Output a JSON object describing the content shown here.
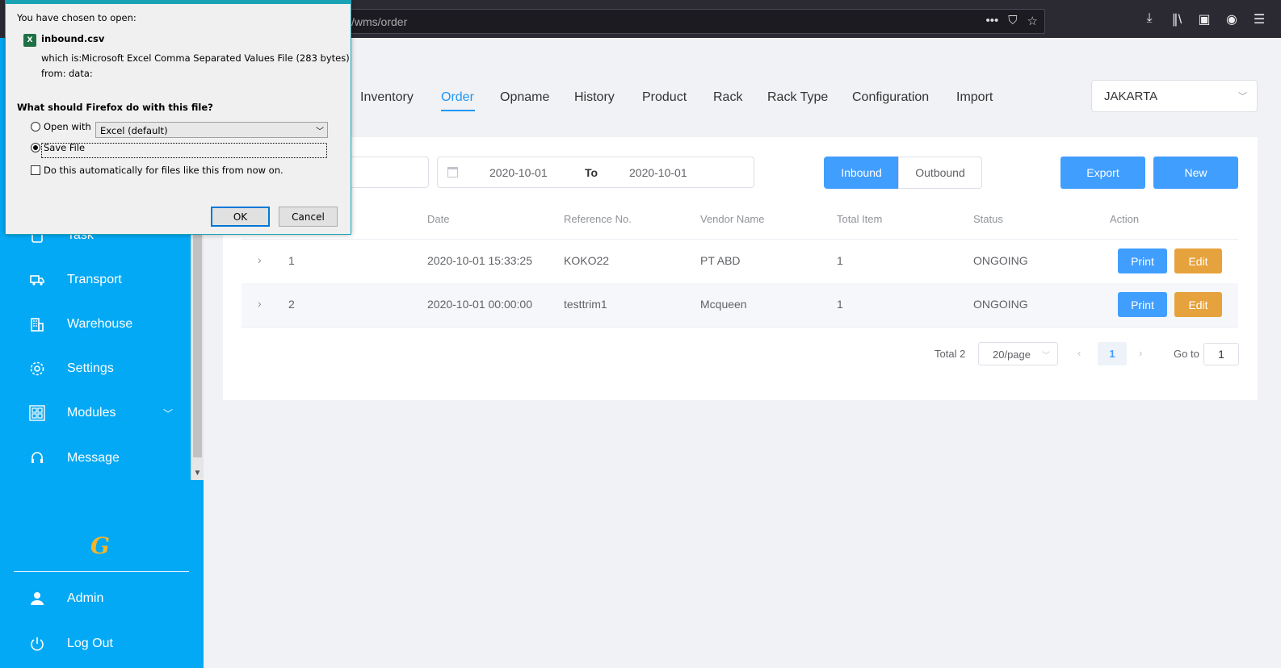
{
  "browser": {
    "url": "/wms/order",
    "url_prefix": "..."
  },
  "sidebar": {
    "items": [
      {
        "label": "Task",
        "icon": "clipboard-icon"
      },
      {
        "label": "Transport",
        "icon": "truck-icon"
      },
      {
        "label": "Warehouse",
        "icon": "building-icon"
      },
      {
        "label": "Settings",
        "icon": "gear-icon"
      },
      {
        "label": "Modules",
        "icon": "modules-icon"
      },
      {
        "label": "Message",
        "icon": "headset-icon"
      }
    ],
    "logo": "G",
    "admin": "Admin",
    "logout": "Log Out"
  },
  "nav": {
    "tabs": [
      "Inventory",
      "Order",
      "Opname",
      "History",
      "Product",
      "Rack",
      "Rack Type",
      "Configuration",
      "Import"
    ],
    "active": "Order",
    "city": "JAKARTA"
  },
  "filters": {
    "date_from": "2020-10-01",
    "to_label": "To",
    "date_to": "2020-10-01",
    "inbound": "Inbound",
    "outbound": "Outbound",
    "export": "Export",
    "new": "New"
  },
  "table": {
    "headers": [
      "Date",
      "Reference No.",
      "Vendor Name",
      "Total Item",
      "Status",
      "Action"
    ],
    "rows": [
      {
        "no": "1",
        "date": "2020-10-01 15:33:25",
        "ref": "KOKO22",
        "vendor": "PT ABD",
        "total": "1",
        "status": "ONGOING"
      },
      {
        "no": "2",
        "date": "2020-10-01 00:00:00",
        "ref": "testtrim1",
        "vendor": "Mcqueen",
        "total": "1",
        "status": "ONGOING"
      }
    ],
    "print": "Print",
    "edit": "Edit"
  },
  "pagination": {
    "total": "Total 2",
    "page_size": "20/page",
    "current": "1",
    "goto_label": "Go to",
    "goto_value": "1"
  },
  "dialog": {
    "intro": "You have chosen to open:",
    "filename": "inbound.csv",
    "which_is_label": "which is:",
    "which_is": "Microsoft Excel Comma Separated Values File (283 bytes)",
    "from_label": "from:",
    "from": "data:",
    "question": "What should Firefox do with this file?",
    "open_with": "Open with",
    "open_with_app": "Excel (default)",
    "save_file": "Save File",
    "auto": "Do this automatically for files like this from now on.",
    "ok": "OK",
    "cancel": "Cancel"
  },
  "colors": {
    "sidebar": "#03a9f4",
    "primary": "#409eff",
    "warning": "#e6a23c",
    "dialog_border": "#1aa3b5"
  }
}
